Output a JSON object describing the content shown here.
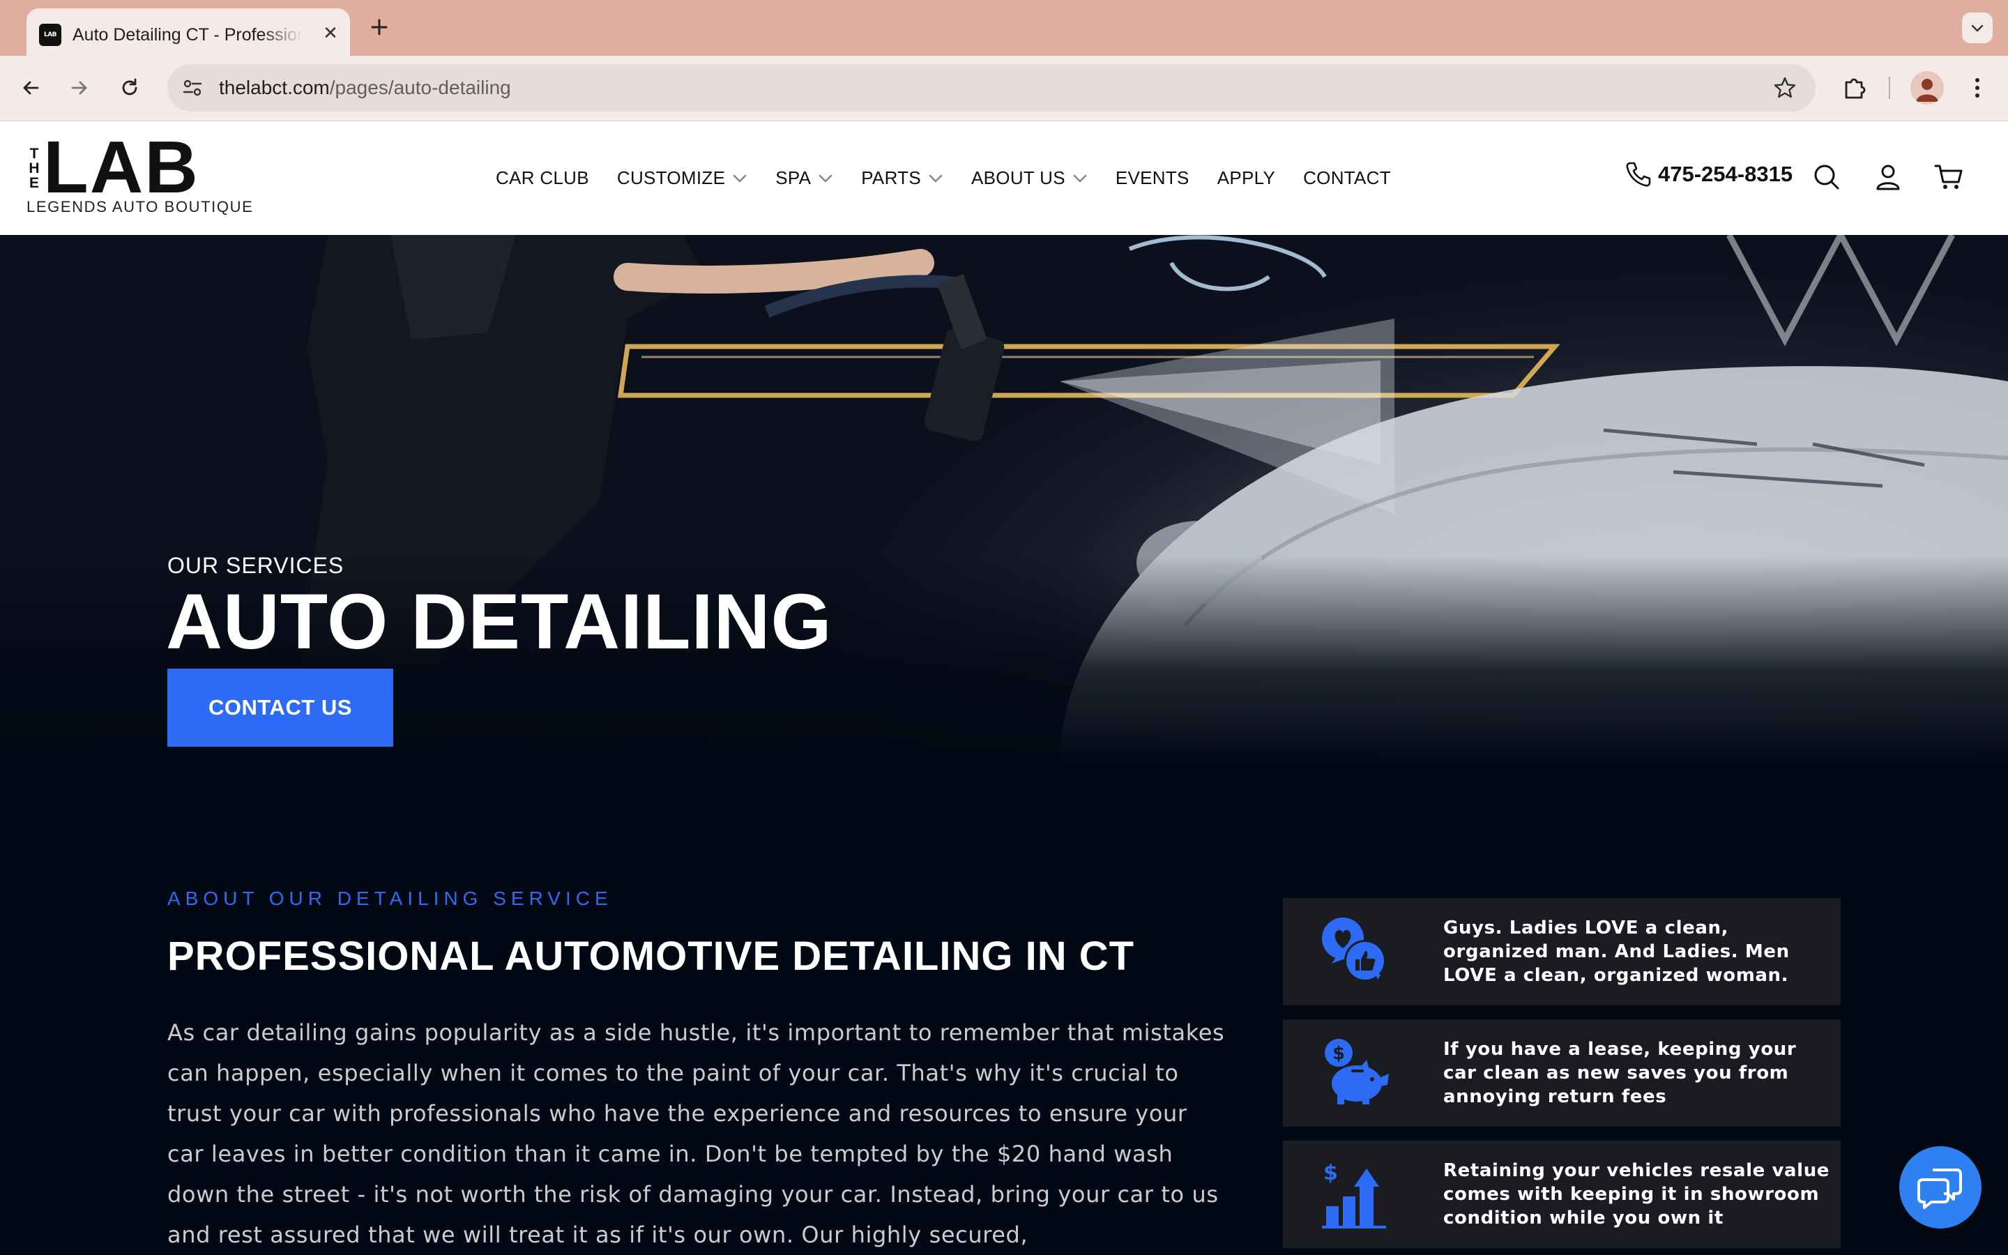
{
  "browser": {
    "tab_title": "Auto Detailing CT - Professional Auto Detailing",
    "tab_favicon_text": "LAB",
    "close_symbol": "✕",
    "new_tab_symbol": "+",
    "url_host": "thelabct.com",
    "url_path": "/pages/auto-detailing"
  },
  "header": {
    "logo_the": [
      "T",
      "H",
      "E"
    ],
    "logo_lab": "LAB",
    "logo_subtitle": "LEGENDS AUTO BOUTIQUE",
    "nav": [
      {
        "label": "CAR CLUB",
        "dropdown": false
      },
      {
        "label": "CUSTOMIZE",
        "dropdown": true
      },
      {
        "label": "SPA",
        "dropdown": true
      },
      {
        "label": "PARTS",
        "dropdown": true
      },
      {
        "label": "ABOUT US",
        "dropdown": true
      },
      {
        "label": "EVENTS",
        "dropdown": false
      },
      {
        "label": "APPLY",
        "dropdown": false
      },
      {
        "label": "CONTACT",
        "dropdown": false
      }
    ],
    "phone": "475-254-8315"
  },
  "hero": {
    "eyebrow": "OUR SERVICES",
    "title": "AUTO DETAILING",
    "button": "CONTACT US"
  },
  "about": {
    "label": "ABOUT OUR DETAILING SERVICE",
    "title": "PROFESSIONAL AUTOMOTIVE DETAILING IN CT",
    "body": "As car detailing gains popularity as a side hustle, it's important to remember that mistakes can happen, especially when it comes to the paint of your car. That's why it's crucial to trust your car with professionals who have the experience and resources to ensure your car leaves in better condition than it came in. Don't be tempted by the $20 hand wash down the street - it's not worth the risk of damaging your car. Instead, bring your car to us and rest assured that we will treat it as if it's our own. Our highly secured,"
  },
  "features": [
    {
      "icon": "heart-thumbs-up-icon",
      "text": "Guys. Ladies LOVE a clean, organized man. And Ladies. Men LOVE a clean, organized woman."
    },
    {
      "icon": "piggy-bank-dollar-icon",
      "text": "If you have a lease, keeping your car clean as new saves you from annoying return fees"
    },
    {
      "icon": "growth-chart-dollar-icon",
      "text": "Retaining your vehicles resale value comes with keeping it in showroom condition while you own it"
    }
  ],
  "colors": {
    "accent": "#2e6bf5",
    "page_background": "#030914",
    "tab_strip": "#dfaea0",
    "feature_card": "#1b1c22"
  }
}
